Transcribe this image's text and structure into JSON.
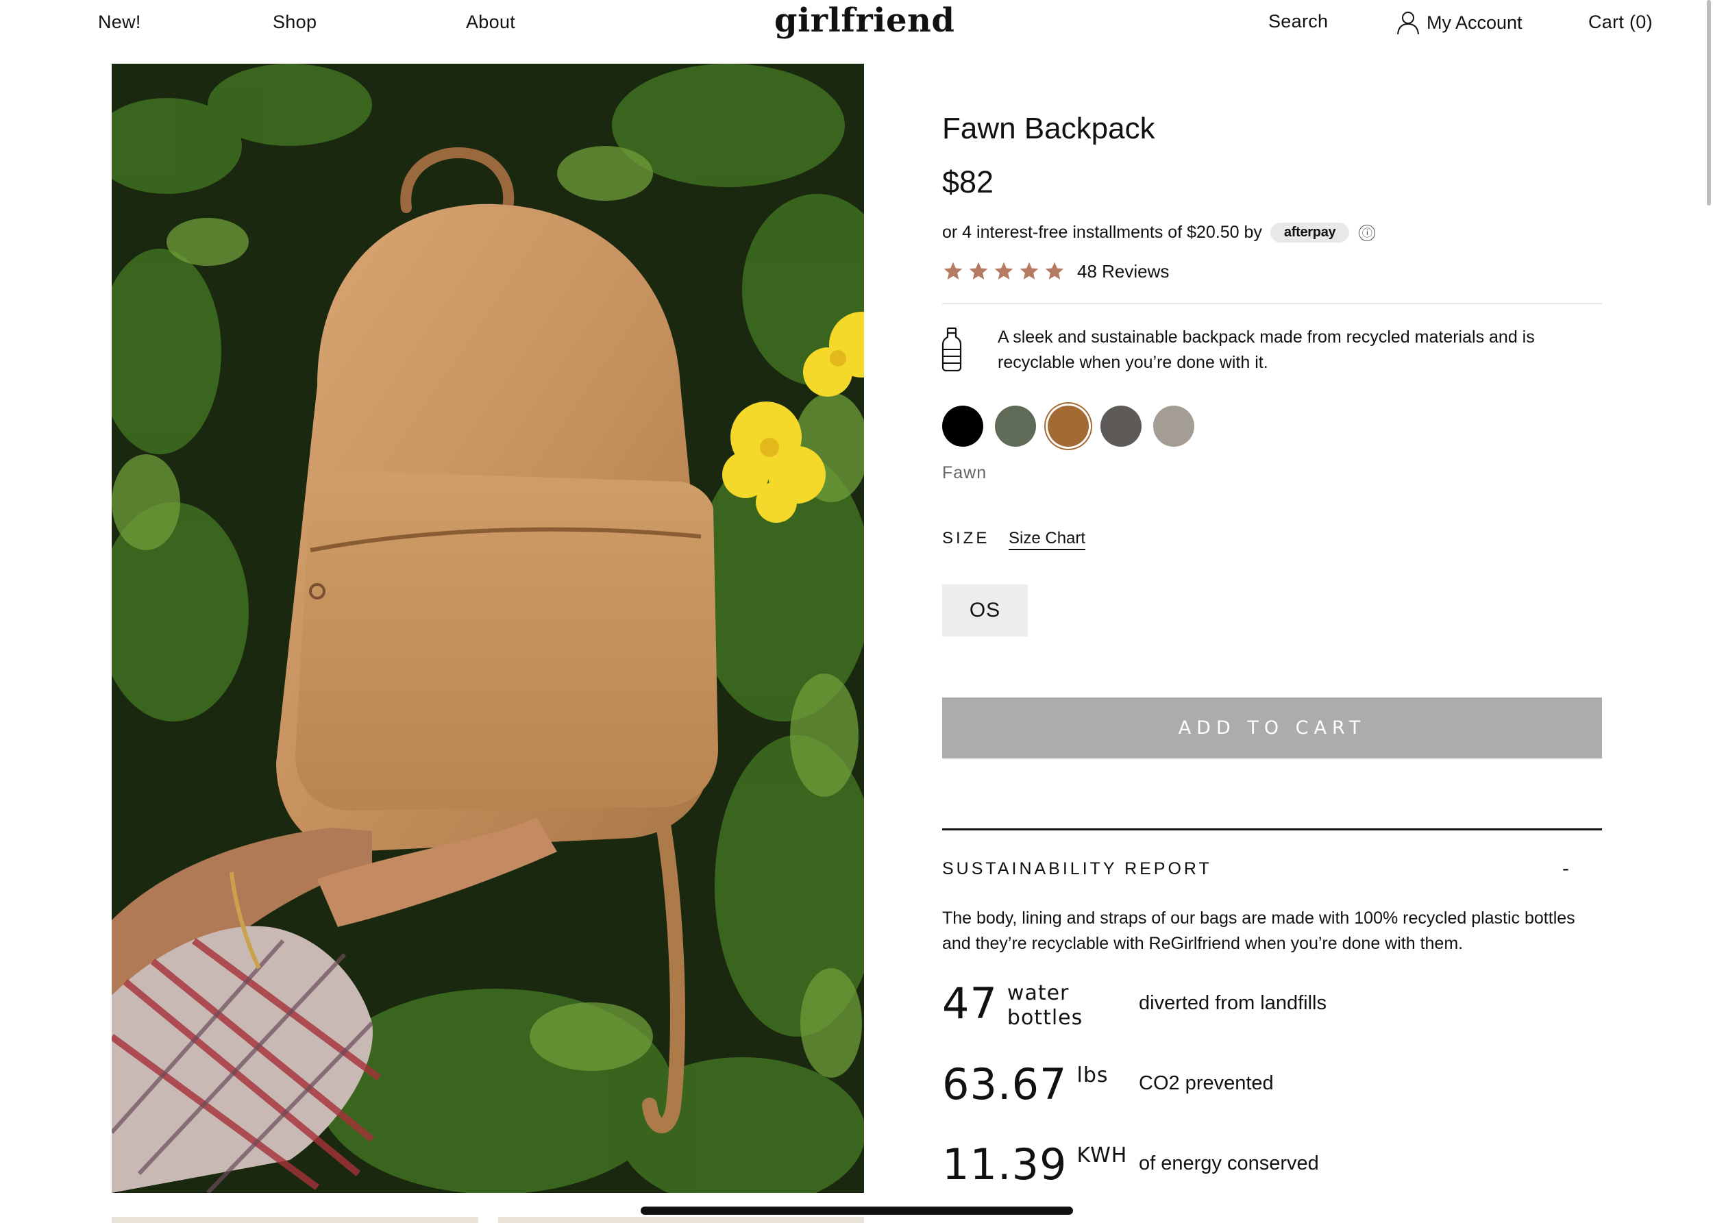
{
  "nav": {
    "new": "New!",
    "shop": "Shop",
    "about": "About",
    "logo": "girlfriend",
    "search": "Search",
    "account": "My Account",
    "cart": "Cart (0)"
  },
  "product": {
    "title": "Fawn Backpack",
    "price": "$82",
    "installments_text": "or 4 interest-free installments of $20.50 by",
    "afterpay_label": "afterpay",
    "info_icon": "ⓘ",
    "rating": 5,
    "reviews": "48 Reviews",
    "description": "A sleek and sustainable backpack made from recycled materials and is recyclable when you’re done with it.",
    "swatches": [
      {
        "color": "#000000",
        "selected": false
      },
      {
        "color": "#5f6a57",
        "selected": false
      },
      {
        "color": "#a46a33",
        "selected": true
      },
      {
        "color": "#5d5a57",
        "selected": false
      },
      {
        "color": "#a39d95",
        "selected": false
      }
    ],
    "selected_color": "Fawn",
    "size_label": "SIZE",
    "size_chart": "Size Chart",
    "size_option": "OS",
    "add_to_cart": "ADD TO CART"
  },
  "sustainability": {
    "title": "SUSTAINABILITY REPORT",
    "toggle": "-",
    "description": "The body, lining and straps of our bags are made with 100% recycled plastic bottles and they’re recyclable with ReGirlfriend when you’re done with them.",
    "stats": [
      {
        "value": "47",
        "unit_line1": "water",
        "unit_line2": "bottles",
        "label": "diverted from landfills"
      },
      {
        "value": "63.67",
        "unit_line1": "lbs",
        "unit_line2": "",
        "label": "CO2 prevented"
      },
      {
        "value": "11.39",
        "unit_line1": "KWH",
        "unit_line2": "",
        "label": "of energy conserved"
      }
    ]
  },
  "icons": {
    "account": "user-icon",
    "star": "star-icon",
    "eco": "bottle-icon"
  },
  "colors": {
    "star": "#b57a62",
    "add_to_cart_bg": "#acacac"
  }
}
